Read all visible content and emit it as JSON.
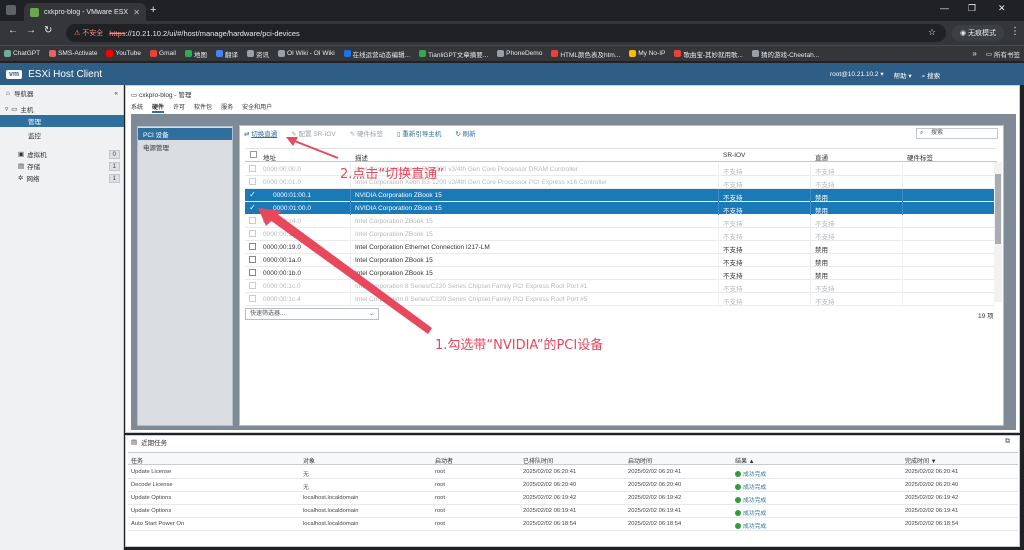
{
  "browser": {
    "tab_title": "cxkpro-blog - VMware ESXi",
    "insecure_label": "不安全",
    "url": "https://10.21.10.2/ui/#/host/manage/hardware/pci-devices",
    "url_scheme": "https",
    "url_rest": "://10.21.10.2/ui/#/host/manage/hardware/pci-devices",
    "incognito_label": "无痕模式"
  },
  "bookmarks": [
    {
      "label": "ChatGPT",
      "color": "#74aa9c"
    },
    {
      "label": "SMS-Activate",
      "color": "#e06666"
    },
    {
      "label": "YouTube",
      "color": "#ff0000"
    },
    {
      "label": "Gmail",
      "color": "#ea4335"
    },
    {
      "label": "地图",
      "color": "#34a853"
    },
    {
      "label": "翻译",
      "color": "#4285f4"
    },
    {
      "label": "资讯",
      "color": "#9aa0a6"
    },
    {
      "label": "OI Wiki - OI Wiki",
      "color": "#9aa0a6"
    },
    {
      "label": "在线运营动态编辑...",
      "color": "#1a73e8"
    },
    {
      "label": "TianliGPT文章摘要...",
      "color": "#34a853"
    },
    {
      "label": "PhoneDemo",
      "color": "#9aa0a6"
    },
    {
      "label": "HTML颜色表及htm...",
      "color": "#ea4335"
    },
    {
      "label": "My No-IP",
      "color": "#fbbc04"
    },
    {
      "label": "歌曲宝-其妙就用歌...",
      "color": "#ea4335"
    },
    {
      "label": "猜的游戏-Cheetah...",
      "color": "#9aa0a6"
    }
  ],
  "bookmarks_all": "所有书签",
  "esxi": {
    "logo": "vm",
    "brand": "ESXi Host Client",
    "user": "root@10.21.10.2 ▾",
    "help": "帮助 ▾",
    "search": "搜索"
  },
  "navigator": {
    "title": "导航器",
    "host": "主机",
    "manage": "管理",
    "monitor": "监控",
    "vms": "虚拟机",
    "vms_count": "0",
    "storage": "存储",
    "storage_count": "1",
    "network": "网络",
    "network_count": "1"
  },
  "main": {
    "breadcrumb": "cxkpro-blog - 管理",
    "tabs": [
      "系统",
      "硬件",
      "许可",
      "软件包",
      "服务",
      "安全和用户"
    ],
    "active_tab": "硬件",
    "side_items": [
      "PCI 设备",
      "电源管理"
    ]
  },
  "toolbar": {
    "toggle_passthrough": "切换直通",
    "configure_sriov": "配置 SR-IOV",
    "hardware_label": "硬件标签",
    "reboot_host": "重新引导主机",
    "refresh": "刷新",
    "search_placeholder": "搜索"
  },
  "table": {
    "headers": [
      "地址",
      "描述",
      "SR-IOV",
      "直通",
      "硬件标签"
    ],
    "rows": [
      {
        "address": "0000:00:00.0",
        "desc": "Intel Corporation Xeon E3-1200 v3/4th Gen Core Processor DRAM Controller",
        "sriov": "不支持",
        "pass": "不支持",
        "state": "dim"
      },
      {
        "address": "0000:00:01.0",
        "desc": "Intel Corporation Xeon E3-1200 v3/4th Gen Core Processor PCI Express x16 Controller",
        "sriov": "不支持",
        "pass": "不支持",
        "state": "dim"
      },
      {
        "address": "0000:01:00.1",
        "desc": "NVIDIA Corporation ZBook 15",
        "sriov": "不支持",
        "pass": "禁用",
        "state": "sel"
      },
      {
        "address": "0000:01:00.0",
        "desc": "NVIDIA Corporation ZBook 15",
        "sriov": "不支持",
        "pass": "禁用",
        "state": "sel"
      },
      {
        "address": "0000:00:14.0",
        "desc": "Intel Corporation ZBook 15",
        "sriov": "不支持",
        "pass": "不支持",
        "state": "dim"
      },
      {
        "address": "0000:00:16.0",
        "desc": "Intel Corporation ZBook 15",
        "sriov": "不支持",
        "pass": "不支持",
        "state": "dim"
      },
      {
        "address": "0000:00:19.0",
        "desc": "Intel Corporation Ethernet Connection I217-LM",
        "sriov": "不支持",
        "pass": "禁用",
        "state": "normal"
      },
      {
        "address": "0000:00:1a.0",
        "desc": "Intel Corporation ZBook 15",
        "sriov": "不支持",
        "pass": "禁用",
        "state": "normal"
      },
      {
        "address": "0000:00:1b.0",
        "desc": "Intel Corporation ZBook 15",
        "sriov": "不支持",
        "pass": "禁用",
        "state": "normal"
      },
      {
        "address": "0000:00:1c.0",
        "desc": "Intel Corporation 8 Series/C220 Series Chipset Family PCI Express Root Port #1",
        "sriov": "不支持",
        "pass": "不支持",
        "state": "dim"
      },
      {
        "address": "0000:00:1c.4",
        "desc": "Intel Corporation 8 Series/C220 Series Chipset Family PCI Express Root Port #5",
        "sriov": "不支持",
        "pass": "不支持",
        "state": "dim"
      }
    ],
    "filter_placeholder": "快速筛选器...",
    "count": "19 项"
  },
  "annotations": {
    "step2": "2.点击“切换直通”",
    "step1": "1.勾选带“NVIDIA”的PCI设备",
    "color": "#e8485b"
  },
  "tasks": {
    "title": "近期任务",
    "headers": [
      "任务",
      "对象",
      "启动者",
      "已排队时间",
      "启动时间",
      "结果 ▲",
      "完成时间 ▼"
    ],
    "rows": [
      [
        "Update License",
        "无",
        "root",
        "2025/02/02 06:20:41",
        "2025/02/02 06:20:41",
        "成功完成",
        "2025/02/02 06:20:41"
      ],
      [
        "Decode License",
        "无",
        "root",
        "2025/02/02 06:20:40",
        "2025/02/02 06:20:40",
        "成功完成",
        "2025/02/02 06:20:40"
      ],
      [
        "Update Options",
        "localhost.localdomain",
        "root",
        "2025/02/02 06:19:42",
        "2025/02/02 06:19:42",
        "成功完成",
        "2025/02/02 06:19:42"
      ],
      [
        "Update Options",
        "localhost.localdomain",
        "root",
        "2025/02/02 06:19:41",
        "2025/02/02 06:19:41",
        "成功完成",
        "2025/02/02 06:19:41"
      ],
      [
        "Auto Start Power On",
        "localhost.localdomain",
        "root",
        "2025/02/02 06:18:54",
        "2025/02/02 06:18:54",
        "成功完成",
        "2025/02/02 06:18:54"
      ]
    ]
  }
}
